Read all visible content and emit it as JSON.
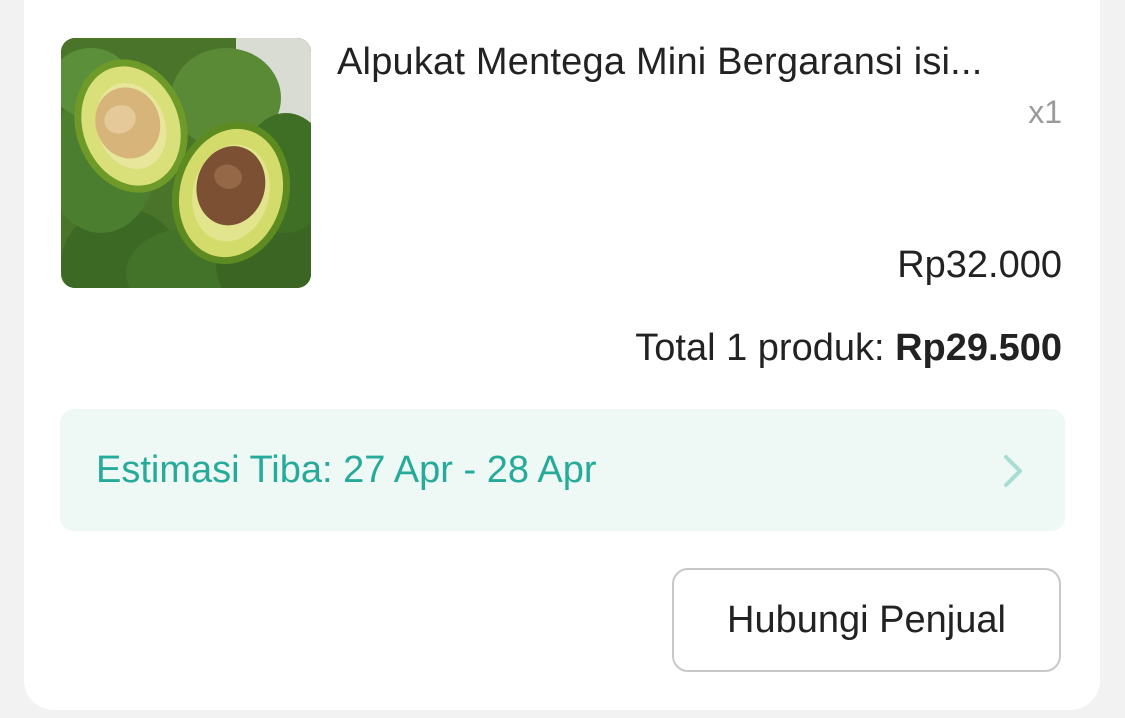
{
  "order_item": {
    "product_name": "Alpukat Mentega Mini Bergaransi isi...",
    "quantity": "x1",
    "price": "Rp32.000",
    "image_subject": "avocado"
  },
  "summary": {
    "total_label": "Total 1 produk: ",
    "total_amount": "Rp29.500"
  },
  "delivery": {
    "estimate_label": "Estimasi Tiba: 27 Apr - 28 Apr"
  },
  "actions": {
    "contact_seller_label": "Hubungi Penjual"
  },
  "colors": {
    "accent_teal": "#26aa99",
    "estimate_background": "#eef8f5",
    "badge_orange": "#ee4d2d"
  },
  "icons": {
    "estimate_arrow": "chevron-right-icon"
  }
}
